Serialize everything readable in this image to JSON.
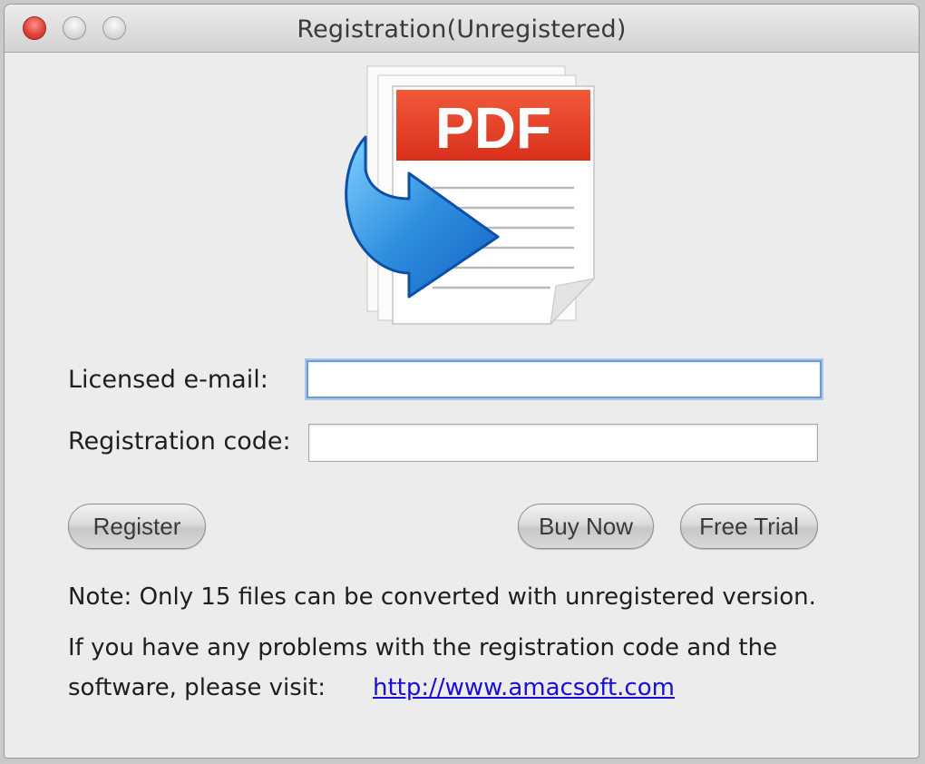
{
  "window": {
    "title": "Registration(Unregistered)"
  },
  "logo": {
    "text": "PDF",
    "accent_color": "#e8401f",
    "arrow_color": "#2f8fdf"
  },
  "form": {
    "email_label": "Licensed e-mail:",
    "email_value": "",
    "code_label": "Registration code:",
    "code_value": ""
  },
  "buttons": {
    "register": "Register",
    "buy_now": "Buy Now",
    "free_trial": "Free Trial"
  },
  "notes": {
    "limit": "Note: Only 15 files can be converted with unregistered version.",
    "help_line1": "If you have any problems with the registration code and the",
    "help_line2": "software, please visit:",
    "url": "http://www.amacsoft.com"
  },
  "colors": {
    "link": "#1a0dd6",
    "focus_ring": "#6f9ad2"
  }
}
